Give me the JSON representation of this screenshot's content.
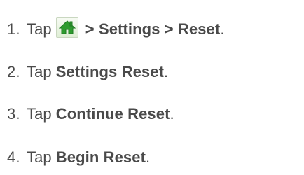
{
  "steps": [
    {
      "number": "1.",
      "verb": "Tap",
      "icon": "home-icon",
      "path": "> Settings > Reset",
      "end": "."
    },
    {
      "number": "2.",
      "verb": "Tap",
      "term": "Settings Reset",
      "end": "."
    },
    {
      "number": "3.",
      "verb": "Tap",
      "term": "Continue Reset",
      "end": "."
    },
    {
      "number": "4.",
      "verb": "Tap",
      "term": "Begin Reset",
      "end": "."
    }
  ],
  "colors": {
    "text": "#4a4a4a",
    "home_icon_fill": "#2e9b2f",
    "home_tile_bg": "#e9f4e2"
  }
}
